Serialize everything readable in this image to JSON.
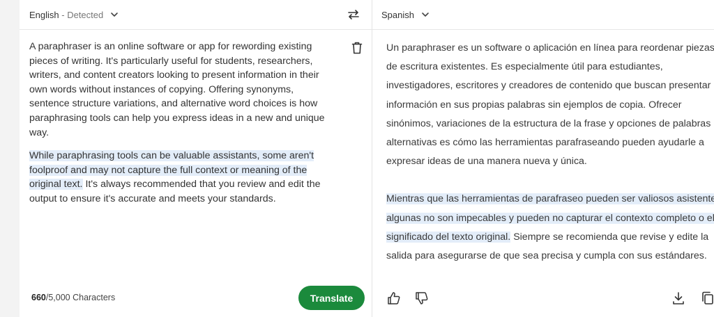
{
  "source": {
    "language": "English",
    "detected_label": "- Detected",
    "paragraphs": [
      "A paraphraser is an online software or app for rewording existing pieces of writing. It's particularly useful for students, researchers, writers, and content creators looking to present information in their own words without instances of copying. Offering synonyms, sentence structure variations, and alternative word choices is how paraphrasing tools can help you express ideas in a new and unique way."
    ],
    "p2_highlight": "While paraphrasing tools can be valuable assistants, some aren't foolproof and may not capture the full context or meaning of the original text.",
    "p2_rest": " It's always recommended that you review and edit the output to ensure it's accurate and meets your standards.",
    "char_count": "660",
    "char_limit": "/5,000 Characters",
    "translate_label": "Translate"
  },
  "target": {
    "language": "Spanish",
    "p1": "Un paraphraser es un software o aplicación en línea para reordenar piezas de escritura existentes. Es especialmente útil para estudiantes, investigadores, escritores y creadores de contenido que buscan presentar información en sus propias palabras sin ejemplos de copia. Ofrecer sinónimos, variaciones de la estructura de la frase y opciones de palabras alternativas es cómo las herramientas parafraseando pueden ayudarle a expresar ideas de una manera nueva y única.",
    "p2_highlight": "Mientras que las herramientas de parafraseo pueden ser valiosos asistentes, algunas no son impecables y pueden no capturar el contexto completo o el significado del texto original.",
    "p2_rest": " Siempre se recomienda que revise y edite la salida para asegurarse de que sea precisa y cumpla con sus estándares."
  },
  "colors": {
    "accent_green": "#1b8a3c",
    "highlight": "#e3edf9"
  },
  "icons": [
    "chevron-down-icon",
    "swap-arrows-icon",
    "trash-icon",
    "thumbs-up-icon",
    "thumbs-down-icon",
    "download-icon",
    "copy-icon"
  ]
}
